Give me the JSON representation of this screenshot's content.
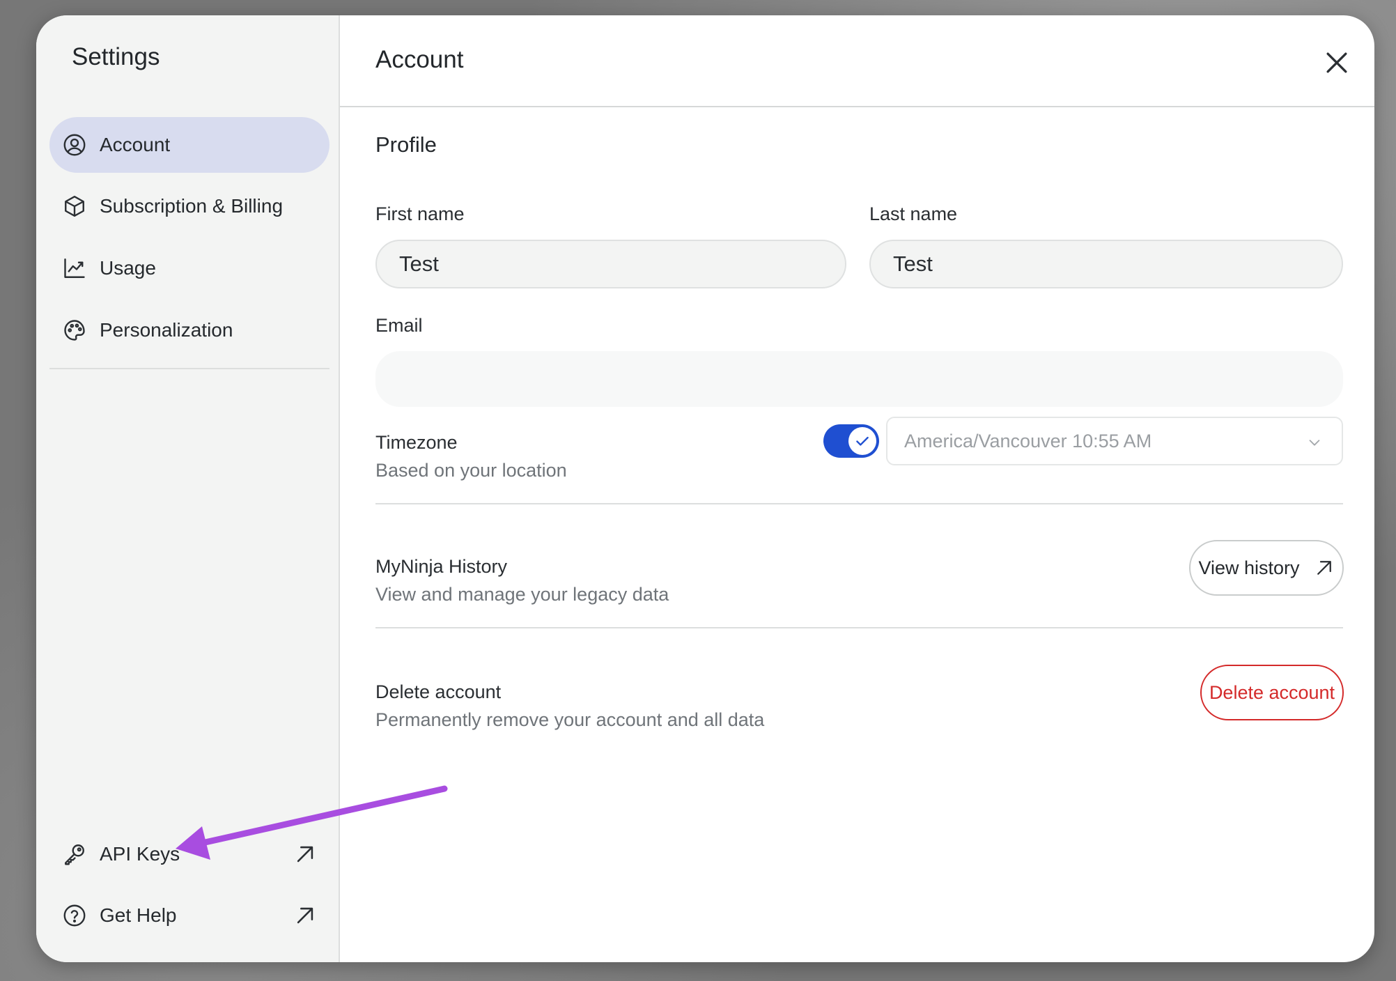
{
  "sidebar": {
    "title": "Settings",
    "items": [
      {
        "label": "Account",
        "icon": "user-circle-icon",
        "active": true
      },
      {
        "label": "Subscription & Billing",
        "icon": "cube-icon"
      },
      {
        "label": "Usage",
        "icon": "chart-line-icon"
      },
      {
        "label": "Personalization",
        "icon": "palette-icon"
      }
    ],
    "bottom_items": [
      {
        "label": "API Keys",
        "icon": "key-icon",
        "external": true
      },
      {
        "label": "Get Help",
        "icon": "help-circle-icon",
        "external": true
      }
    ]
  },
  "header": {
    "title": "Account"
  },
  "profile": {
    "section_title": "Profile",
    "first_name_label": "First name",
    "first_name_value": "Test",
    "last_name_label": "Last name",
    "last_name_value": "Test",
    "email_label": "Email",
    "email_value": ""
  },
  "timezone": {
    "label": "Timezone",
    "sublabel": "Based on your location",
    "toggle_on": true,
    "selected": "America/Vancouver 10:55 AM"
  },
  "history": {
    "title": "MyNinja History",
    "subtitle": "View and manage your legacy data",
    "button_label": "View history"
  },
  "delete": {
    "title": "Delete account",
    "subtitle": "Permanently remove your account and all data",
    "button_label": "Delete account"
  },
  "colors": {
    "accent": "#1f4fd1",
    "active_nav": "#d8dcef",
    "danger": "#d42a2a",
    "annotation_arrow": "#a84de0"
  }
}
